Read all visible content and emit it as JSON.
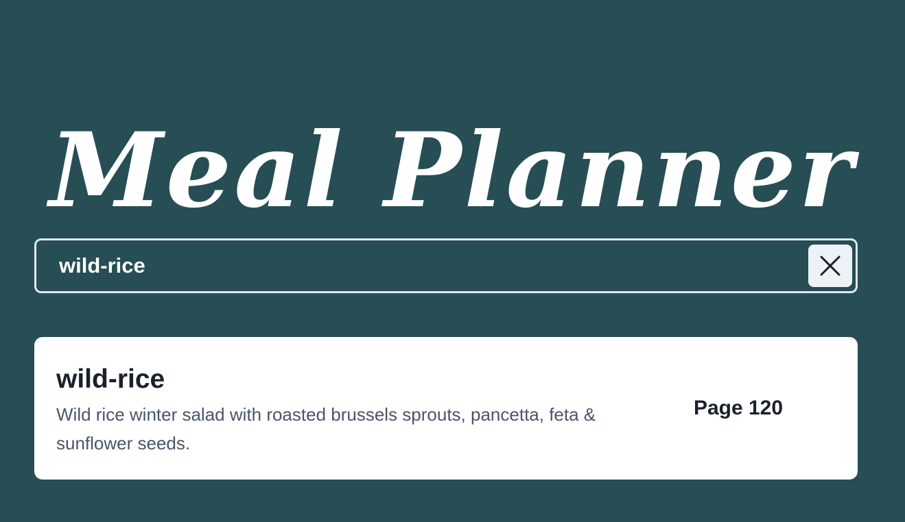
{
  "app": {
    "title": "Meal Planner"
  },
  "search": {
    "value": "wild-rice",
    "clear_icon": "close-icon"
  },
  "results": [
    {
      "name": "wild-rice",
      "description": "Wild rice winter salad with roasted brussels sprouts, pancetta, feta & sunflower seeds.",
      "page": "Page 120"
    }
  ],
  "colors": {
    "background": "#264e54",
    "card": "#ffffff",
    "text_primary": "#1a202c",
    "text_secondary": "#4a5568",
    "search_border": "#e2e8f0",
    "clear_button": "#edf2f7"
  }
}
